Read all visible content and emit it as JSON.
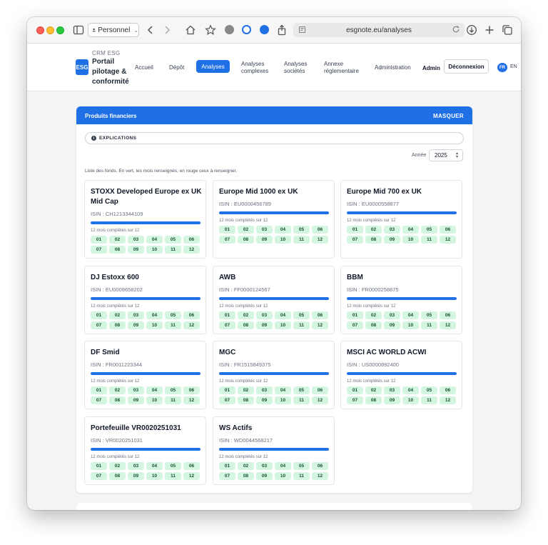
{
  "browser": {
    "profile": "Personnel",
    "url": "esgnote.eu/analyses"
  },
  "header": {
    "logo_text": "ESG",
    "brand_small": "CRM ESG",
    "brand_title": "Portail pilotage & conformité",
    "nav": {
      "accueil": "Accueil",
      "depot": "Dépôt",
      "analyses": "Analyses",
      "analyses_complexes": "Analyses complexes",
      "analyses_societes": "Analyses sociétés",
      "annexe": "Annexe réglementaire",
      "administration": "Administration"
    },
    "admin": "Admin",
    "logout": "Déconnexion",
    "lang_fr": "FR",
    "lang_en": "EN"
  },
  "panel": {
    "title": "Produits financiers",
    "hide": "MASQUER",
    "explanations": "EXPLICATIONS",
    "year_label": "Année",
    "year_value": "2025",
    "list_note": "Liste des fonds. En vert, les mois renseignés, en rouge ceux à renseigner."
  },
  "funds": [
    {
      "name": "STOXX Developed Europe ex UK Mid Cap",
      "isin": "ISIN : CH1213344109",
      "progress_label": "12 mois complétés sur 12",
      "completion": 1.0
    },
    {
      "name": "Europe Mid 1000 ex UK",
      "isin": "ISIN : EU0000456789",
      "progress_label": "12 mois complétés sur 12",
      "completion": 1.0
    },
    {
      "name": "Europe Mid 700 ex UK",
      "isin": "ISIN : EU0000558877",
      "progress_label": "12 mois complétés sur 12",
      "completion": 1.0
    },
    {
      "name": "DJ Estoxx 600",
      "isin": "ISIN : EU0009658202",
      "progress_label": "12 mois complétés sur 12",
      "completion": 1.0
    },
    {
      "name": "AWB",
      "isin": "ISIN : FF0000124567",
      "progress_label": "12 mois complétés sur 12",
      "completion": 1.0
    },
    {
      "name": "BBM",
      "isin": "ISIN : FR0000258875",
      "progress_label": "12 mois complétés sur 12",
      "completion": 1.0
    },
    {
      "name": "DF Smid",
      "isin": "ISIN : FR0011223344",
      "progress_label": "12 mois complétés sur 12",
      "completion": 1.0
    },
    {
      "name": "MGC",
      "isin": "ISIN : FR1515849375",
      "progress_label": "12 mois complétés sur 12",
      "completion": 1.0
    },
    {
      "name": "MSCI AC WORLD ACWI",
      "isin": "ISIN : US0000892400",
      "progress_label": "12 mois complétés sur 12",
      "completion": 1.0
    },
    {
      "name": "Portefeuille VR0020251031",
      "isin": "ISIN : VR0020251031",
      "progress_label": "12 mois complétés sur 12",
      "completion": 1.0
    },
    {
      "name": "WS Actifs",
      "isin": "ISIN : WD0044568217",
      "progress_label": "12 mois complétés sur 12",
      "completion": 1.0
    }
  ],
  "months": [
    "01",
    "02",
    "03",
    "04",
    "05",
    "06",
    "07",
    "08",
    "09",
    "10",
    "11",
    "12"
  ],
  "colors": {
    "accent": "#1f6fe5",
    "month_filled": "#d4f5e0"
  }
}
